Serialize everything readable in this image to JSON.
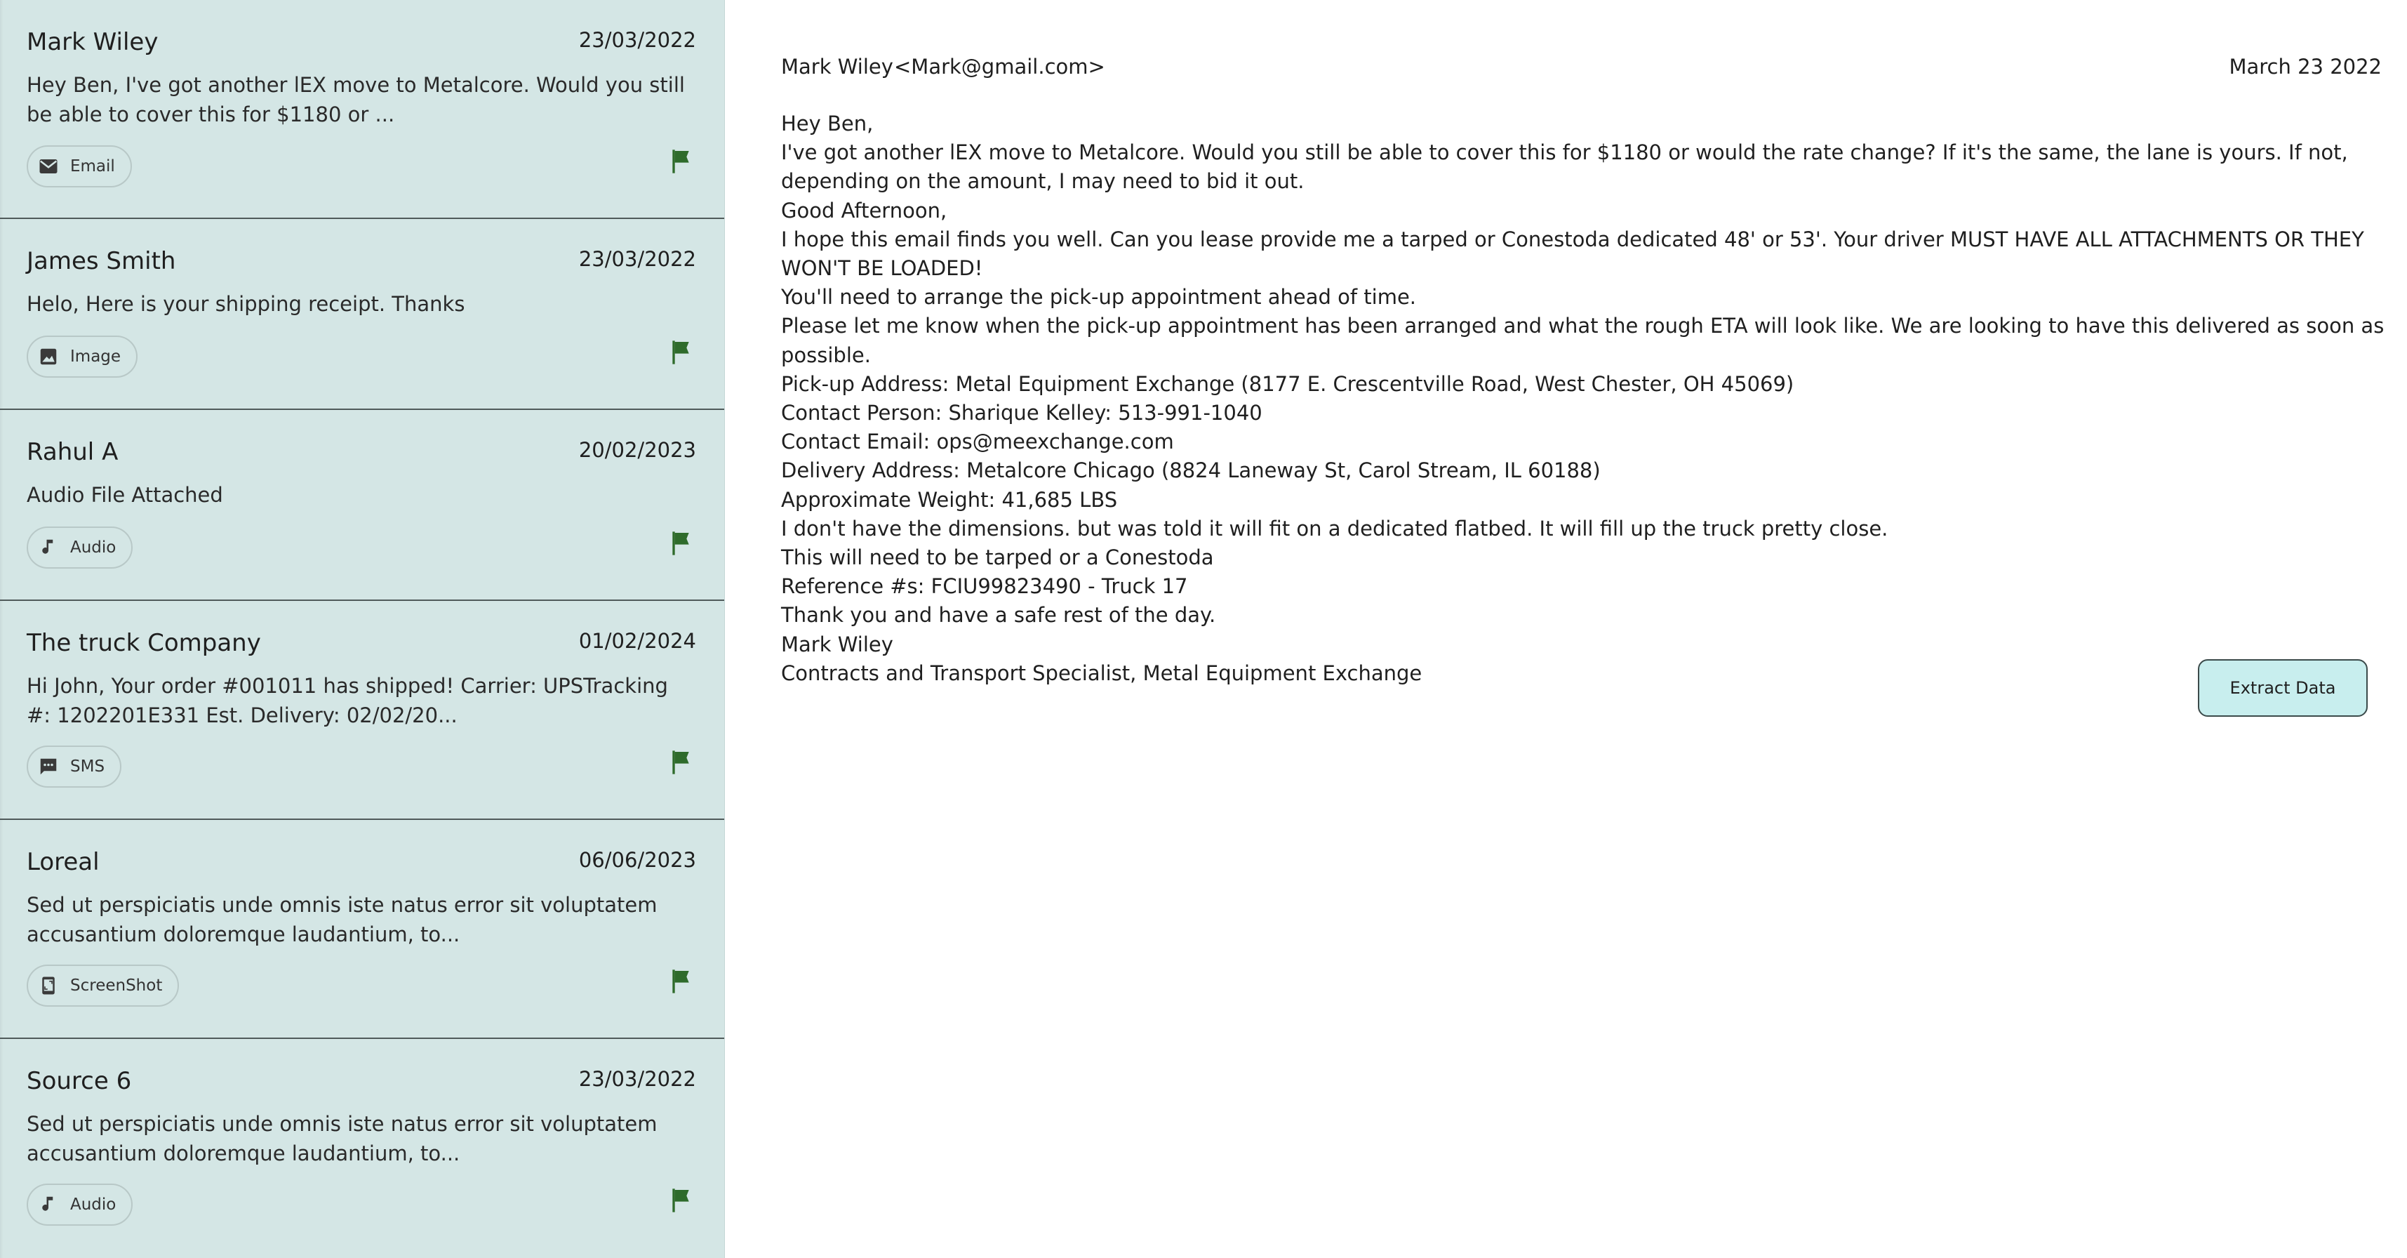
{
  "messages": [
    {
      "sender": "Mark Wiley",
      "date": "23/03/2022",
      "preview": "Hey Ben, I've got another lEX move to Metalcore. Would you still be able to cover this for $1180 or ...",
      "source_label": "Email",
      "source_icon": "email-icon",
      "flag_color": "#2e6b2b"
    },
    {
      "sender": "James Smith",
      "date": "23/03/2022",
      "preview": "Helo, Here is your shipping receipt. Thanks",
      "source_label": "Image",
      "source_icon": "image-icon",
      "flag_color": "#2e6b2b"
    },
    {
      "sender": "Rahul A",
      "date": "20/02/2023",
      "preview": "Audio File Attached",
      "source_label": "Audio",
      "source_icon": "music-note-icon",
      "flag_color": "#2e6b2b"
    },
    {
      "sender": "The truck Company",
      "date": "01/02/2024",
      "preview": "Hi John, Your order #001011 has shipped! Carrier: UPSTracking #: 1202201E331 Est. Delivery: 02/02/20...",
      "source_label": "SMS",
      "source_icon": "sms-icon",
      "flag_color": "#2e6b2b"
    },
    {
      "sender": "Loreal",
      "date": "06/06/2023",
      "preview": "Sed ut perspiciatis unde omnis iste natus error sit voluptatem accusantium doloremque laudantium, to...",
      "source_label": "ScreenShot",
      "source_icon": "screenshot-icon",
      "flag_color": "#2e6b2b"
    },
    {
      "sender": "Source 6",
      "date": "23/03/2022",
      "preview": "Sed ut perspiciatis unde omnis iste natus error sit voluptatem accusantium doloremque laudantium, to...",
      "source_label": "Audio",
      "source_icon": "music-note-icon",
      "flag_color": "#2e6b2b"
    }
  ],
  "reader": {
    "from_name": "Mark Wiley",
    "from_email": "<Mark@gmail.com>",
    "date": "March 23 2022",
    "body_lines": [
      "Hey Ben,",
      "I've got another lEX move to Metalcore. Would you still be able to cover this for $1180 or would the rate change? If it's the same, the lane is yours. If not, depending on the amount, I may need to bid it out.",
      "Good Afternoon,",
      "I hope this email finds you well. Can you lease provide me a tarped or Conestoda dedicated 48' or 53'. Your driver MUST HAVE ALL ATTACHMENTS OR THEY WON'T BE LOADED!",
      "You'll need to arrange the pick-up appointment ahead of time.",
      "Please let me know when the pick-up appointment has been arranged and what the rough ETA will look like. We are looking to have this delivered as soon as possible.",
      "Pick-up Address: Metal Equipment Exchange (8177 E. Crescentville Road, West Chester, OH 45069)",
      "Contact Person: Sharique Kelley: 513-991-1040",
      "Contact Email: ops@meexchange.com",
      "Delivery Address: Metalcore Chicago (8824 Laneway St, Carol Stream, IL 60188)",
      "Approximate Weight: 41,685 LBS",
      "I don't have the dimensions. but was told it will fit on a dedicated flatbed. It will fill up the truck pretty close.",
      "This will need to be tarped or a Conestoda",
      "Reference #s: FCIU99823490 - Truck 17",
      "Thank you and have a safe rest of the day.",
      "Mark Wiley",
      "Contracts and Transport Specialist, Metal Equipment Exchange"
    ],
    "extract_button_label": "Extract Data"
  },
  "colors": {
    "sidebar_bg": "#d4e6e5",
    "card_divider": "#4f5a5a",
    "flag": "#2e6b2b",
    "button_bg": "#c8eeee"
  }
}
